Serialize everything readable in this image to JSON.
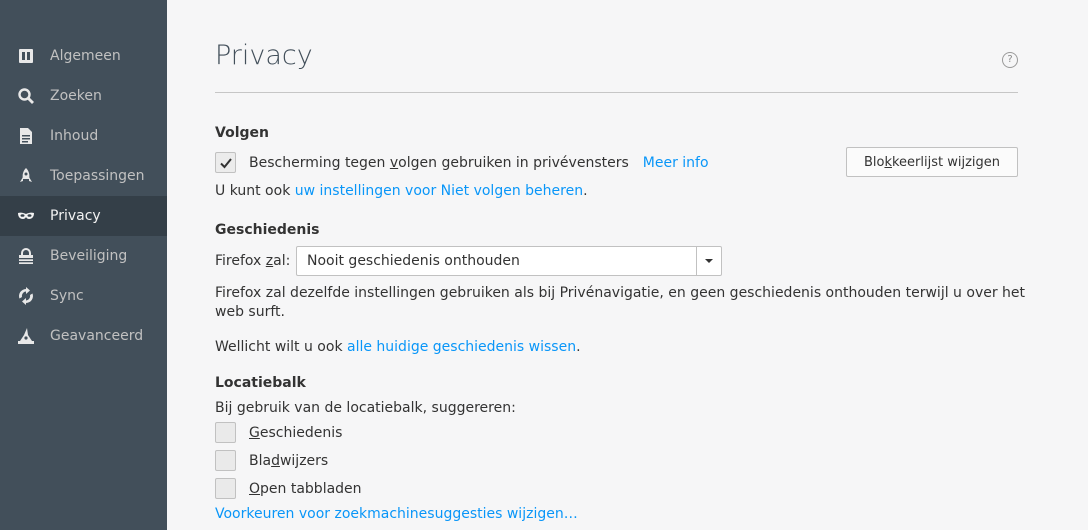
{
  "sidebar": {
    "items": [
      {
        "label": "Algemeen",
        "icon": "general-icon"
      },
      {
        "label": "Zoeken",
        "icon": "search-icon"
      },
      {
        "label": "Inhoud",
        "icon": "content-icon"
      },
      {
        "label": "Toepassingen",
        "icon": "applications-icon"
      },
      {
        "label": "Privacy",
        "icon": "privacy-mask-icon",
        "selected": true
      },
      {
        "label": "Beveiliging",
        "icon": "security-icon"
      },
      {
        "label": "Sync",
        "icon": "sync-icon"
      },
      {
        "label": "Geavanceerd",
        "icon": "advanced-icon"
      }
    ]
  },
  "page": {
    "title": "Privacy",
    "help": "?"
  },
  "tracking": {
    "heading": "Volgen",
    "checkbox_label_a": "Bescherming tegen ",
    "checkbox_label_mnemonic": "v",
    "checkbox_label_b": "olgen gebruiken in privévensters",
    "checked": true,
    "learn_more": "Meer info",
    "block_button_a": "Blo",
    "block_button_mnemonic": "k",
    "block_button_b": "keerlijst wijzigen",
    "dnt_prefix": "U kunt ook ",
    "dnt_link": "uw instellingen voor Niet volgen beheren",
    "dnt_suffix": "."
  },
  "history": {
    "heading": "Geschiedenis",
    "label_a": "Firefox ",
    "label_mnemonic": "z",
    "label_b": "al:",
    "select_value": "Nooit geschiedenis onthouden",
    "description_line1": "Firefox zal dezelfde instellingen gebruiken als bij Privénavigatie, en geen geschiedenis onthouden terwijl u over het",
    "description_line2": "web surft.",
    "clear_prefix": "Wellicht wilt u ook ",
    "clear_link": "alle huidige geschiedenis wissen",
    "clear_suffix": "."
  },
  "locationbar": {
    "heading": "Locatiebalk",
    "intro": "Bij gebruik van de locatiebalk, suggereren:",
    "options": [
      {
        "mnemonic": "G",
        "rest": "eschiedenis",
        "pre": "",
        "checked": false
      },
      {
        "pre": "Bla",
        "mnemonic": "d",
        "rest": "wijzers",
        "checked": false
      },
      {
        "pre": "",
        "mnemonic": "O",
        "rest": "pen tabbladen",
        "checked": false
      }
    ],
    "search_suggestions_link": "Voorkeuren voor zoekmachinesuggesties wijzigen…"
  },
  "colors": {
    "sidebar_bg": "#424f5a",
    "sidebar_selected": "#343f48",
    "link": "#0996f8"
  }
}
